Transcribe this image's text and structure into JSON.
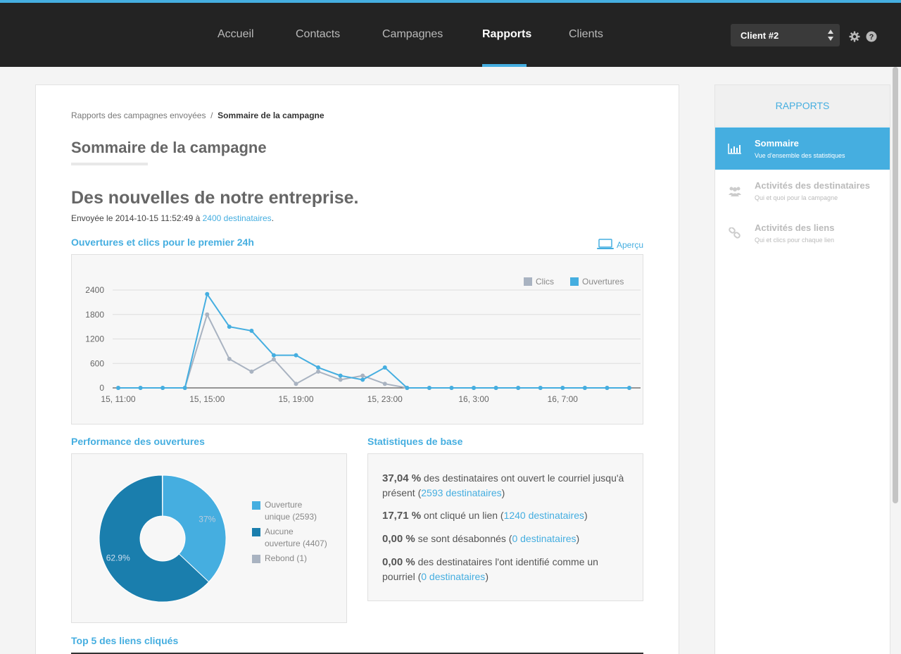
{
  "nav": {
    "items": [
      "Accueil",
      "Contacts",
      "Campagnes",
      "Rapports",
      "Clients"
    ],
    "active": "Rapports",
    "client": "Client #2"
  },
  "breadcrumb": {
    "parent": "Rapports des campagnes envoyées",
    "separator": "/",
    "current": "Sommaire de la campagne"
  },
  "page_title": "Sommaire de la campagne",
  "campaign": {
    "title": "Des nouvelles de notre entreprise.",
    "sent_prefix": "Envoyée le 2014-10-15 11:52:49 à",
    "recipients_link": "2400 destinataires",
    "sent_suffix": "."
  },
  "sections": {
    "chart": "Ouvertures et clics pour le premier 24h",
    "preview": "Aperçu",
    "performance": "Performance des ouvertures",
    "stats": "Statistiques de base",
    "top5": "Top 5 des liens cliqués"
  },
  "stats": [
    {
      "pct": "37,04 %",
      "text": " des destinataires ont ouvert le courriel jusqu'à présent (",
      "link": "2593 destinataires",
      "end": ")"
    },
    {
      "pct": "17,71 %",
      "text": " ont cliqué un lien (",
      "link": "1240 destinataires",
      "end": ")"
    },
    {
      "pct": "0,00 %",
      "text": " se sont désabonnés (",
      "link": "0 destinataires",
      "end": ")"
    },
    {
      "pct": "0,00 %",
      "text": " des destinataires l'ont identifié comme un pourriel (",
      "link": "0 destinataires",
      "end": ")"
    }
  ],
  "sidebar": {
    "title": "RAPPORTS",
    "items": [
      {
        "title": "Sommaire",
        "subtitle": "Vue d'ensemble des statistiques",
        "active": true,
        "icon": "bar-chart-icon"
      },
      {
        "title": "Activités des destinataires",
        "subtitle": "Qui et quoi pour la campagne",
        "active": false,
        "icon": "users-icon"
      },
      {
        "title": "Activités des liens",
        "subtitle": "Qui et clics pour chaque lien",
        "active": false,
        "icon": "link-icon"
      }
    ]
  },
  "colors": {
    "accent": "#45aee0",
    "clics": "#a9b3c1",
    "ouvertures": "#45aee0",
    "pie_unique": "#45aee0",
    "pie_none": "#1a7ead",
    "pie_bounce": "#a9b3c1"
  },
  "chart_data": [
    {
      "type": "line",
      "x": [
        "15, 11:00",
        "15, 12:00",
        "15, 13:00",
        "15, 14:00",
        "15, 15:00",
        "15, 16:00",
        "15, 17:00",
        "15, 18:00",
        "15, 19:00",
        "15, 20:00",
        "15, 21:00",
        "15, 22:00",
        "15, 23:00",
        "16, 0:00",
        "16, 1:00",
        "16, 2:00",
        "16, 3:00",
        "16, 4:00",
        "16, 5:00",
        "16, 6:00",
        "16, 7:00",
        "16, 8:00",
        "16, 9:00",
        "16, 10:00"
      ],
      "xticks": [
        "15, 11:00",
        "15, 15:00",
        "15, 19:00",
        "15, 23:00",
        "16, 3:00",
        "16, 7:00"
      ],
      "yticks": [
        0,
        600,
        1200,
        1800,
        2400
      ],
      "ylim": [
        0,
        2400
      ],
      "legend": "top-right",
      "grid": true,
      "series": [
        {
          "name": "Clics",
          "values": [
            0,
            0,
            0,
            0,
            1800,
            710,
            400,
            700,
            100,
            400,
            200,
            300,
            100,
            0,
            0,
            0,
            0,
            0,
            0,
            0,
            0,
            0,
            0,
            0
          ]
        },
        {
          "name": "Ouvertures",
          "values": [
            0,
            0,
            0,
            0,
            2300,
            1500,
            1400,
            800,
            800,
            500,
            300,
            200,
            500,
            0,
            0,
            0,
            0,
            0,
            0,
            0,
            0,
            0,
            0,
            0
          ]
        }
      ]
    },
    {
      "type": "pie",
      "categories": [
        "Ouverture unique (2593)",
        "Aucune ouverture (4407)",
        "Rebond (1)"
      ],
      "values": [
        37,
        62.9,
        0.1
      ],
      "data_labels": [
        "37%",
        "62.9%",
        ""
      ]
    }
  ]
}
